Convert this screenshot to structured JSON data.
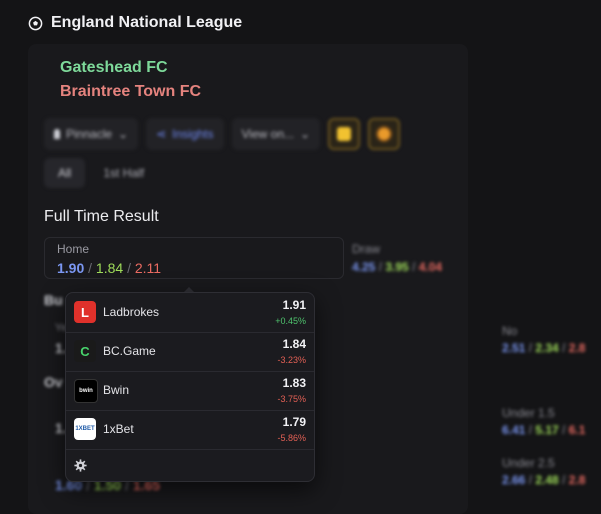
{
  "league": {
    "title": "England National League"
  },
  "match": {
    "home_team": "Gateshead FC",
    "away_team": "Braintree Town FC"
  },
  "toolbar": {
    "bookmaker_select": "Pinnacle",
    "insights_label": "Insights",
    "view_select": "View on..."
  },
  "tabs": [
    {
      "label": "All",
      "active": true
    },
    {
      "label": "1st Half",
      "active": false
    }
  ],
  "market": {
    "title": "Full Time Result",
    "home": {
      "label": "Home",
      "best": "1.90",
      "avg": "1.84",
      "low": "2.11"
    },
    "draw": {
      "label": "Draw",
      "best": "4.25",
      "avg": "3.95",
      "low": "4.04"
    }
  },
  "background": {
    "section_b_title": "Bu",
    "section_b_left_label": "Ye",
    "section_b_left_val": "1.",
    "no": {
      "label": "No",
      "best": "2.51",
      "avg": "2.34",
      "low": "2.8"
    },
    "section_o_title": "Ov",
    "under15": {
      "label": "Under 1.5",
      "best": "6.41",
      "avg": "5.17",
      "low": "6.1"
    },
    "under25": {
      "label": "Under 2.5",
      "best": "2.66",
      "avg": "2.48",
      "low": "2.8"
    },
    "left_frag_1": "1.",
    "left_frag_2": "1.",
    "left_bottom": {
      "best": "1.60",
      "avg": "1.50",
      "low": "1.65"
    }
  },
  "popup": {
    "bookmakers": [
      {
        "name": "Ladbrokes",
        "odds": "1.91",
        "change": "+0.45%",
        "trend": "up",
        "logo_text": "L",
        "logo_bg": "#e0312b",
        "logo_fg": "#ffffff"
      },
      {
        "name": "BC.Game",
        "odds": "1.84",
        "change": "-3.23%",
        "trend": "down",
        "logo_text": "C",
        "logo_bg": "#1a1a1a",
        "logo_fg": "#48d36b"
      },
      {
        "name": "Bwin",
        "odds": "1.83",
        "change": "-3.75%",
        "trend": "down",
        "logo_text": "bwin",
        "logo_bg": "#000000",
        "logo_fg": "#ffffff"
      },
      {
        "name": "1xBet",
        "odds": "1.79",
        "change": "-5.86%",
        "trend": "down",
        "logo_text": "1XBET",
        "logo_bg": "#ffffff",
        "logo_fg": "#1e5aa8"
      }
    ],
    "settings_icon": "gear-icon"
  },
  "colors": {
    "accent_blue": "#7b97f2",
    "accent_green": "#9fdc5a",
    "accent_red": "#ea6b62",
    "home_team": "#7ed99a",
    "away_team": "#e5837e"
  }
}
